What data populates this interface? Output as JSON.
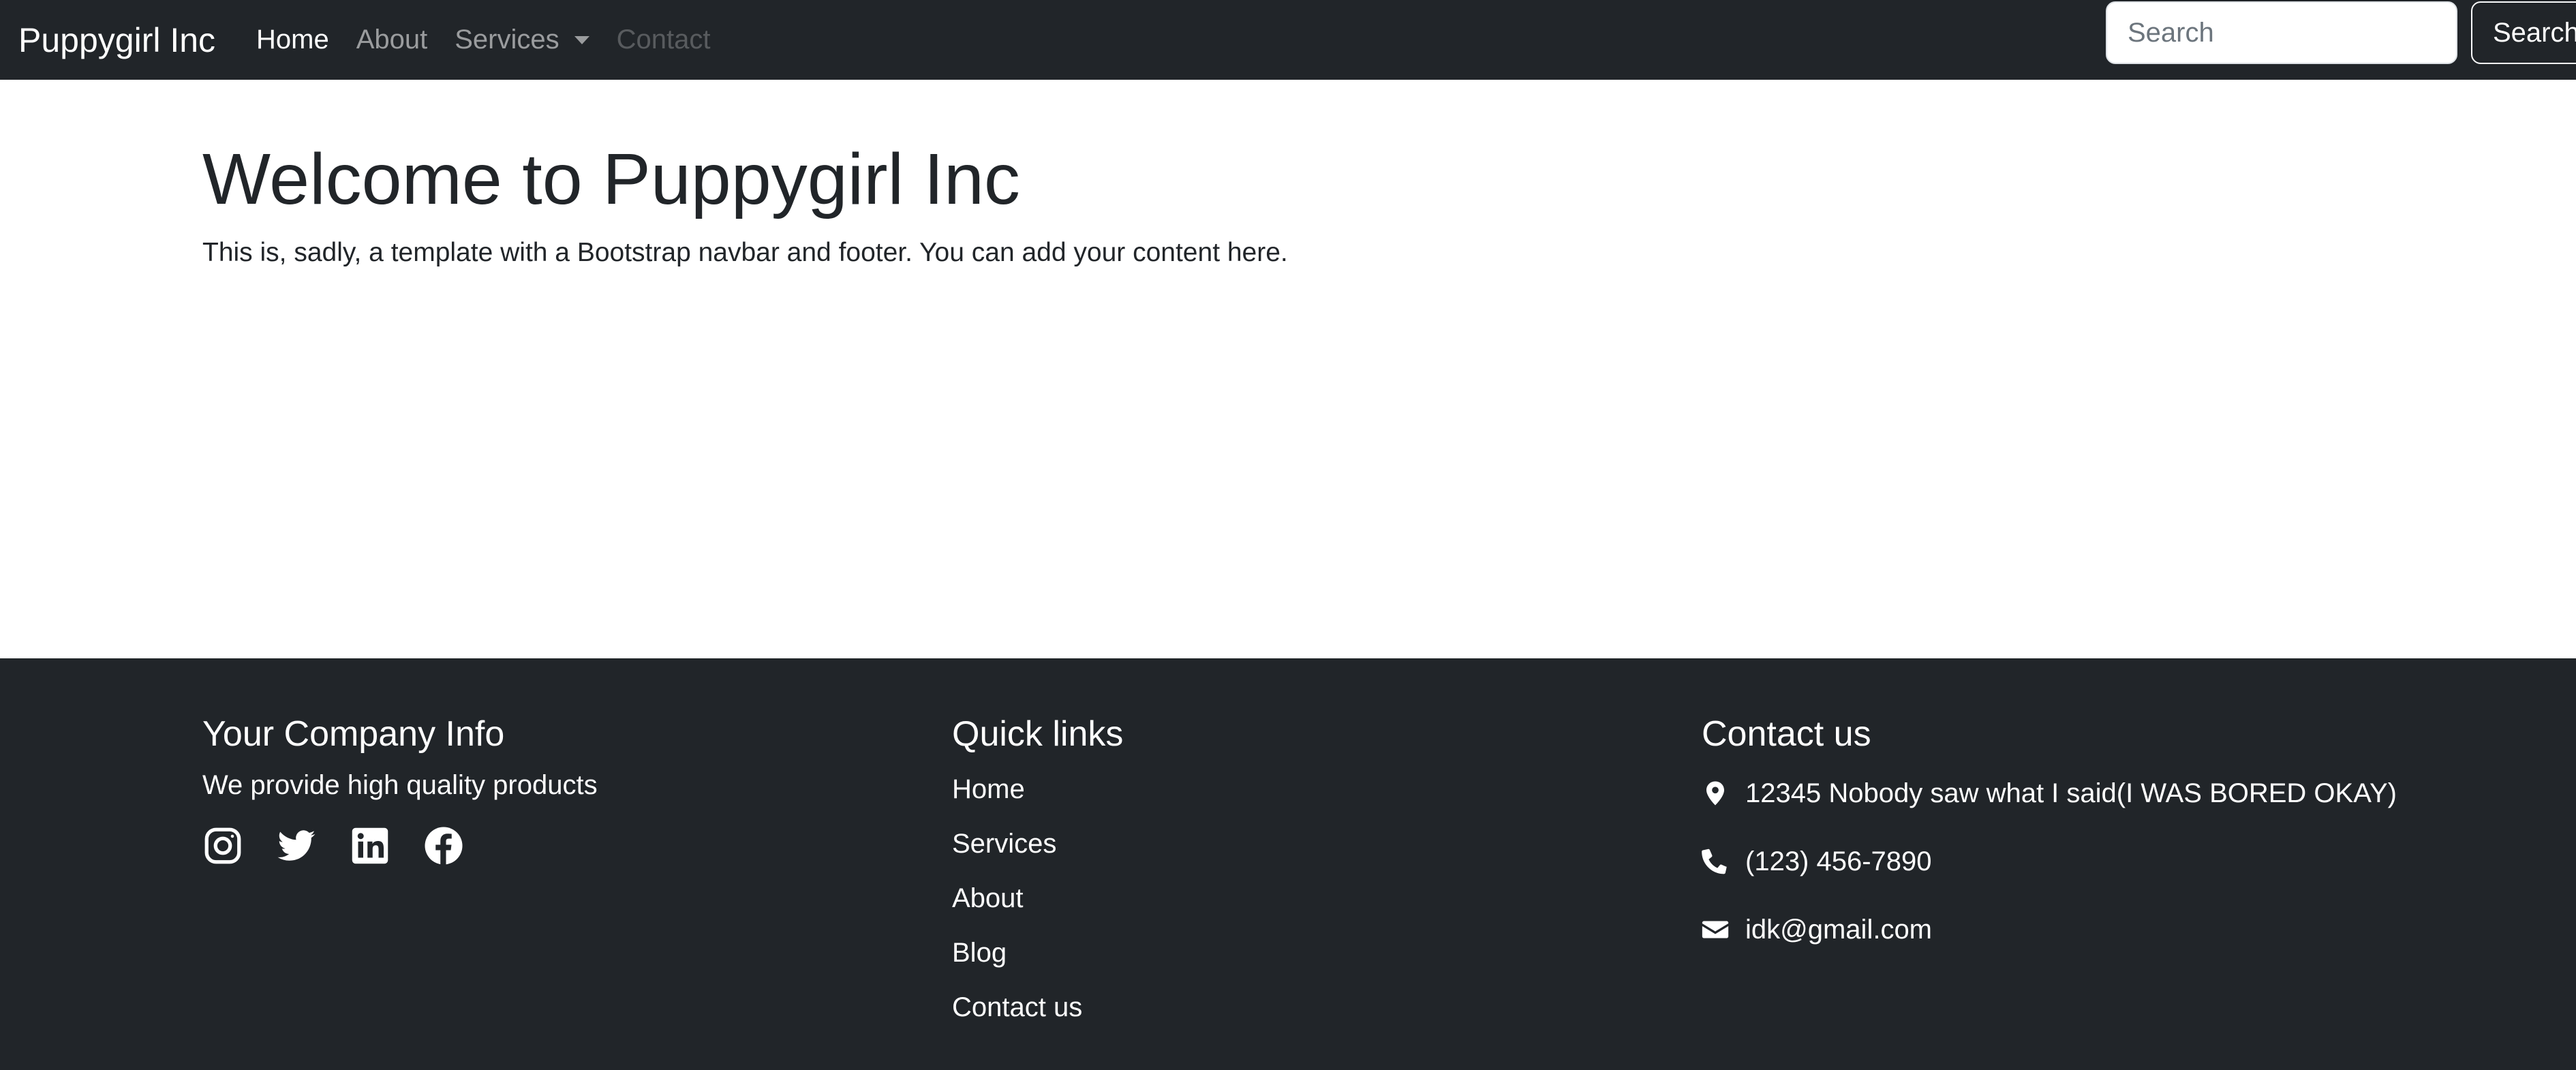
{
  "navbar": {
    "brand": "Puppygirl Inc",
    "links": [
      {
        "label": "Home",
        "state": "active"
      },
      {
        "label": "About",
        "state": "default"
      },
      {
        "label": "Services",
        "state": "dropdown"
      },
      {
        "label": "Contact",
        "state": "disabled"
      }
    ],
    "search_placeholder": "Search",
    "search_button": "Search"
  },
  "main": {
    "title": "Welcome to Puppygirl Inc",
    "lead": "This is, sadly, a template with a Bootstrap navbar and footer. You can add your content here."
  },
  "footer": {
    "company": {
      "heading": "Your Company Info",
      "tagline": "We provide high quality products",
      "social_icons": [
        "instagram-icon",
        "twitter-icon",
        "linkedin-icon",
        "facebook-icon"
      ]
    },
    "quick_links": {
      "heading": "Quick links",
      "items": [
        "Home",
        "Services",
        "About",
        "Blog",
        "Contact us"
      ]
    },
    "contact": {
      "heading": "Contact us",
      "address": "12345 Nobody saw what I said(I WAS BORED OKAY)",
      "phone": "(123) 456-7890",
      "email": "idk@gmail.com",
      "icons": [
        "map-marker-icon",
        "phone-icon",
        "envelope-icon"
      ]
    }
  },
  "colors": {
    "dark_bg": "#212529",
    "text": "#212529",
    "nav_muted": "rgba(255,255,255,0.55)",
    "nav_disabled": "rgba(255,255,255,0.25)"
  }
}
